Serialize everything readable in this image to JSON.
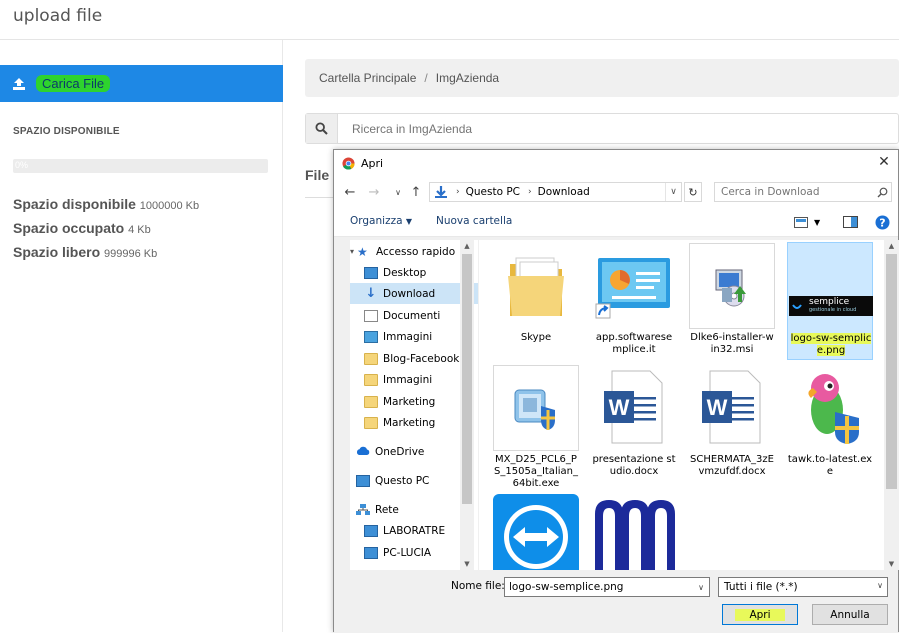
{
  "page": {
    "title": "upload file"
  },
  "sidebar": {
    "upload_label": "Carica File",
    "space_title": "SPAZIO DISPONIBILE",
    "progress_text": "0%",
    "progress_fraction": 0.0,
    "stats": [
      {
        "label": "Spazio disponibile",
        "value": "1000000 Kb"
      },
      {
        "label": "Spazio occupato",
        "value": "4 Kb"
      },
      {
        "label": "Spazio libero",
        "value": "999996 Kb"
      }
    ]
  },
  "main": {
    "breadcrumb": [
      "Cartella Principale",
      "ImgAzienda"
    ],
    "breadcrumb_sep": "/",
    "search_placeholder": "Ricerca in ImgAzienda",
    "file_heading": "File"
  },
  "dialog": {
    "title": "Apri",
    "address": [
      "Questo PC",
      "Download"
    ],
    "search_placeholder": "Cerca in Download",
    "toolbar": {
      "organize": "Organizza",
      "new_folder": "Nuova cartella"
    },
    "nav": [
      {
        "label": "Accesso rapido",
        "icon": "star-icon"
      },
      {
        "label": "Desktop",
        "icon": "desktop-icon",
        "pinned": true
      },
      {
        "label": "Download",
        "icon": "download-icon",
        "pinned": true,
        "selected": true
      },
      {
        "label": "Documenti",
        "icon": "documents-icon",
        "pinned": true
      },
      {
        "label": "Immagini",
        "icon": "pictures-icon",
        "pinned": true
      },
      {
        "label": "Blog-Facebook",
        "icon": "folder-icon"
      },
      {
        "label": "Immagini",
        "icon": "folder-icon"
      },
      {
        "label": "Marketing",
        "icon": "folder-icon"
      },
      {
        "label": "Marketing",
        "icon": "folder-icon"
      },
      {
        "label": "OneDrive",
        "icon": "cloud-icon"
      },
      {
        "label": "Questo PC",
        "icon": "computer-icon"
      },
      {
        "label": "Rete",
        "icon": "network-icon"
      },
      {
        "label": "LABORATRE",
        "icon": "computer-icon"
      },
      {
        "label": "PC-LUCIA",
        "icon": "computer-icon"
      }
    ],
    "files": [
      {
        "name": "Skype",
        "icon": "folder-icon"
      },
      {
        "name": "app.softwaresemplice.it",
        "icon": "shortcut-icon"
      },
      {
        "name": "Dlke6-installer-win32.msi",
        "icon": "installer-icon"
      },
      {
        "name": "logo-sw-semplice.png",
        "icon": "image-icon",
        "selected": true,
        "thumb_text": "semplice",
        "thumb_sub": "gestionale in cloud"
      },
      {
        "name": "MX_D25_PCL6_PS_1505a_Italian_64bit.exe",
        "icon": "setup-icon"
      },
      {
        "name": "presentazione studio.docx",
        "icon": "word-icon"
      },
      {
        "name": "SCHERMATA_3zEvmzufdf.docx",
        "icon": "word-icon"
      },
      {
        "name": "tawk.to-latest.exe",
        "icon": "parrot-icon"
      },
      {
        "name": "",
        "icon": "teamviewer-icon"
      },
      {
        "name": "",
        "icon": "m-logo-icon"
      }
    ],
    "filename_label": "Nome file:",
    "filename_value": "logo-sw-semplice.png",
    "filetype": "Tutti i file (*.*)",
    "open_label": "Apri",
    "cancel_label": "Annulla"
  }
}
